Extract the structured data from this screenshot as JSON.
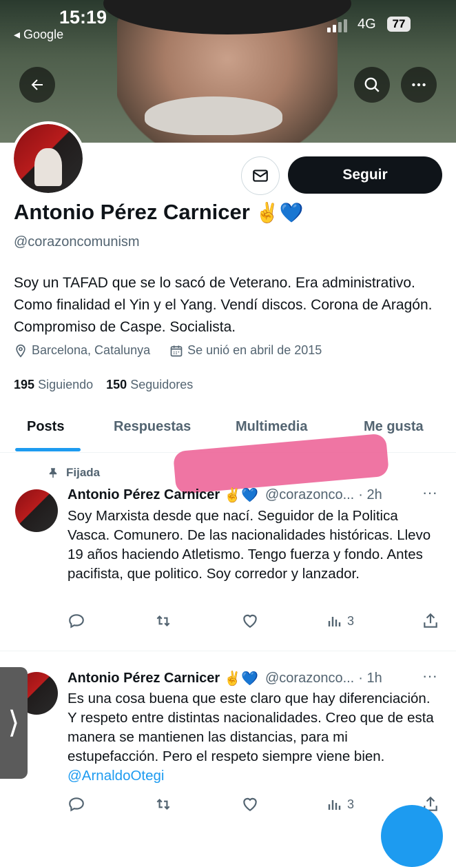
{
  "status_bar": {
    "time": "15:19",
    "back_app": "◂ Google",
    "network": "4G",
    "battery": "77"
  },
  "profile": {
    "name": "Antonio Pérez Carnicer",
    "name_emoji": "✌️💙",
    "handle": "@corazoncomunism",
    "follow_label": "Seguir",
    "bio": "Soy un TAFAD que se lo sacó de Veterano. Era administrativo. Como finalidad el Yin y el Yang. Vendí discos. Corona de Aragón. Compromiso de Caspe. Socialista.",
    "location": "Barcelona, Catalunya",
    "joined": "Se unió en abril de 2015",
    "following_count": "195",
    "following_label": "Siguiendo",
    "followers_count": "150",
    "followers_label": "Seguidores"
  },
  "tabs": [
    {
      "label": "Posts"
    },
    {
      "label": "Respuestas"
    },
    {
      "label": "Multimedia"
    },
    {
      "label": "Me gusta"
    }
  ],
  "pinned_label": "Fijada",
  "posts": [
    {
      "name": "Antonio Pérez Carnicer",
      "emoji": "✌️💙",
      "handle": "@corazonco...",
      "time": "· 2h",
      "text": "Soy Marxista desde que nací. Seguidor de la Politica Vasca.  Comunero. De las nacionalidades históricas. Llevo 19 años haciendo Atletismo. Tengo fuerza y fondo. Antes pacifista, que politico. Soy corredor y lanzador.",
      "views": "3"
    },
    {
      "name": "Antonio Pérez Carnicer",
      "emoji": "✌️💙",
      "handle": "@corazonco...",
      "time": "· 1h",
      "text": "Es una cosa buena que este claro que hay diferenciación. Y respeto entre distintas nacionalidades.  Creo que de esta manera se mantienen las distancias, para mi estupefacción. Pero el respeto siempre viene bien.",
      "mention": "@ArnaldoOtegi",
      "views": "3"
    }
  ],
  "side_tab_glyph": "⟩",
  "colors": {
    "accent": "#1d9bf0",
    "text": "#0f1419",
    "muted": "#536471",
    "highlight": "#ec5d93"
  }
}
